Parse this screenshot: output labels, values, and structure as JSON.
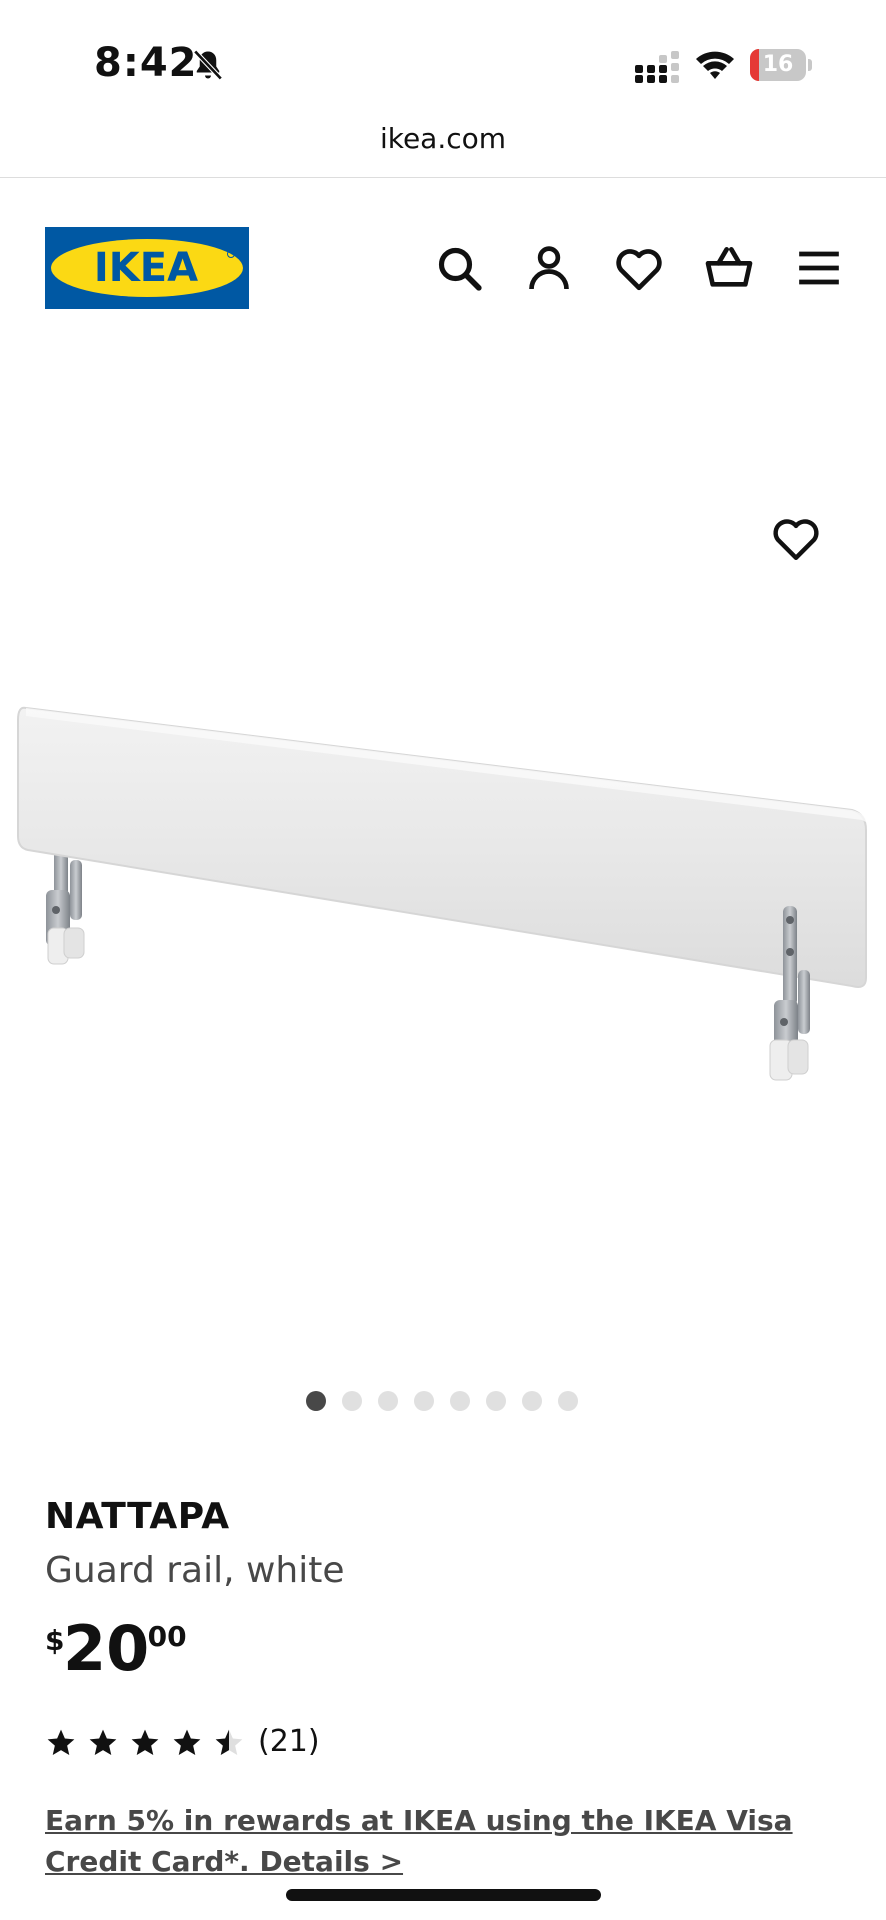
{
  "status_bar": {
    "time": "8:42",
    "battery_level": "16",
    "battery_fraction": 0.16
  },
  "browser": {
    "url": "ikea.com"
  },
  "header": {
    "logo_text": "IKEA",
    "brand_blue": "#0058a3",
    "brand_yellow": "#fbd914",
    "icons": [
      "search-icon",
      "account-icon",
      "heart-icon",
      "cart-icon",
      "menu-icon"
    ]
  },
  "gallery": {
    "image_count": 8,
    "active_index": 0
  },
  "product": {
    "name": "NATTAPA",
    "description": "Guard rail, white",
    "price": {
      "currency": "$",
      "integer": "20",
      "decimal": ".00"
    },
    "rating": 4.5,
    "review_count": "(21)"
  },
  "promo": {
    "text": "Earn 5% in rewards at IKEA using the IKEA Visa Credit Card*. Details >"
  }
}
